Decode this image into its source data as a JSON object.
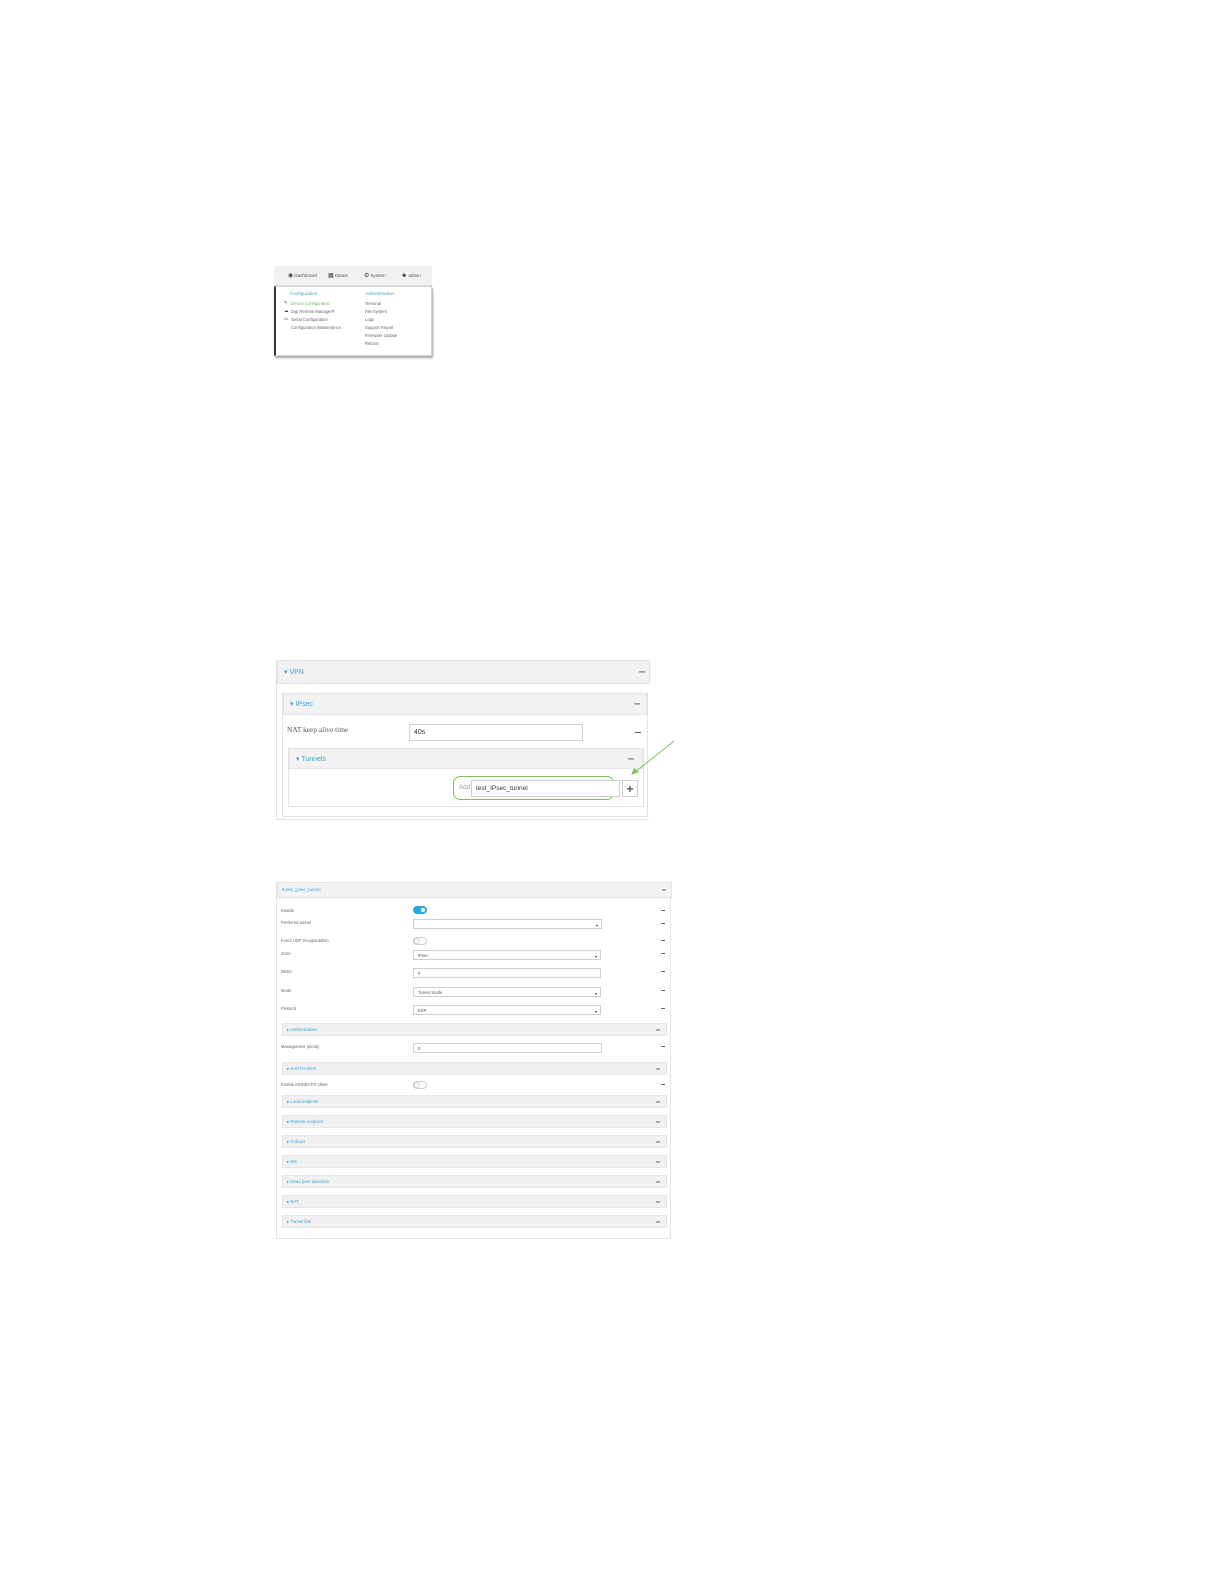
{
  "menu": {
    "nav": {
      "dashboard": "Dashboard",
      "status": "Status",
      "system": "System",
      "admin": "admin"
    },
    "configuration": {
      "heading": "Configuration",
      "items": [
        "Device Configuration",
        "Digi Remote Manager®",
        "Serial Configuration",
        "Configuration Maintenance"
      ]
    },
    "administration": {
      "heading": "Administration",
      "items": [
        "Terminal",
        "File System",
        "Logs",
        "Support Report",
        "Firmware Update",
        "Reboot"
      ]
    }
  },
  "vpn": {
    "vpn_title": "VPN",
    "ipsec_title": "IPsec",
    "nat_label": "NAT keep alive time",
    "nat_value": "40s",
    "tunnels_title": "Tunnels",
    "add_label": "Add",
    "add_value": "test_IPsec_tunnel",
    "add_button": "+"
  },
  "tunnel": {
    "title": "test_ipsec_tunnel",
    "enable_label": "Enable",
    "preferred_tunnel_label": "Preferred tunnel",
    "preferred_tunnel_value": "",
    "force_udp_label": "Force UDP encapsulation",
    "zone_label": "Zone",
    "zone_value": "IPsec",
    "metric_label": "Metric",
    "metric_value": "0",
    "mode_label": "Mode",
    "mode_value": "Tunnel mode",
    "protocol_label": "Protocol",
    "protocol_value": "ESP",
    "authentication": "Authentication",
    "management_priority_label": "Management priority",
    "management_priority_value": "0",
    "xauth_client": "XAUTH client",
    "modecfg_label": "Enable MODECFG client",
    "local_endpoint": "Local endpoint",
    "remote_endpoint": "Remote endpoint",
    "policies": "Policies",
    "ike": "IKE",
    "dpd": "Dead peer detection",
    "nat": "NAT",
    "tunnel_link": "Tunnel link"
  },
  "colors": {
    "link_blue": "#3ea1d2",
    "highlight_green": "#7ec35f",
    "toggle_on": "#2ba8df"
  }
}
